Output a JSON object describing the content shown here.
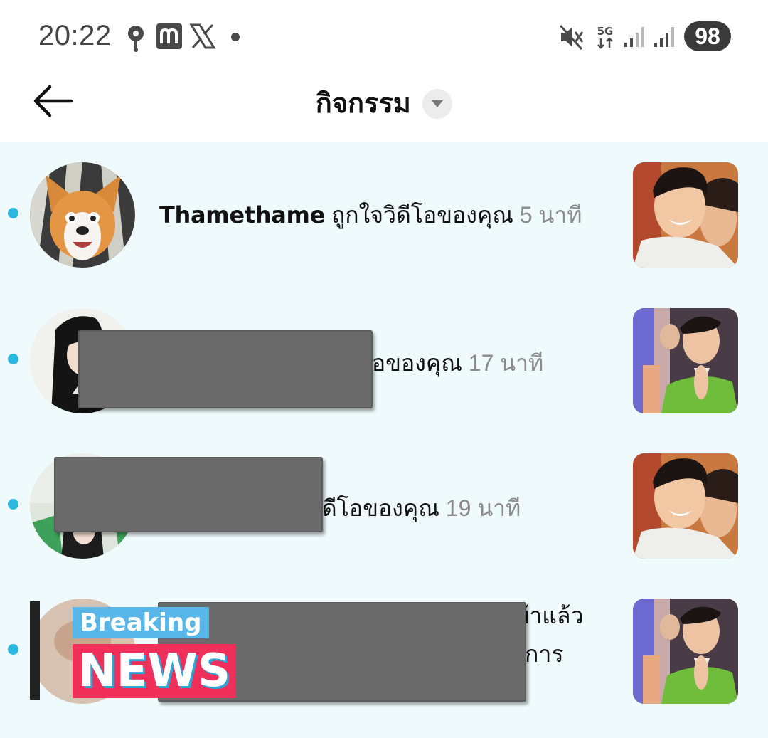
{
  "status_bar": {
    "time": "20:22",
    "left_icons": [
      "location-pin-icon",
      "m-app-icon",
      "x-logo-icon",
      "notification-dot-icon"
    ],
    "right_icons": [
      "mute-icon",
      "5g-network-icon",
      "signal-bars-icon",
      "signal-bars-icon"
    ],
    "network_label": "5G",
    "battery": "98"
  },
  "header": {
    "back_icon": "arrow-left-icon",
    "title": "กิจกรรม",
    "dropdown_icon": "caret-down-icon"
  },
  "colors": {
    "list_background": "#eefafc",
    "unread_dot": "#2ab7e0",
    "time_text": "#8b8b8b",
    "redaction": "#6a6a6a"
  },
  "activities": [
    {
      "username": "Thamethame",
      "action": "ถูกใจวิดีโอของคุณ",
      "time": "5 นาที",
      "unread": true,
      "avatar_icon": "corgi-avatar",
      "thumbnail_icon": "video-thumbnail-smiling"
    },
    {
      "visible_text": "อของคุณ",
      "time": "17 นาที",
      "unread": true,
      "redacted": true,
      "avatar_icon": "dark-hair-avatar",
      "thumbnail_icon": "video-thumbnail-green-shirt"
    },
    {
      "visible_text": "ดีโอของคุณ",
      "time": "19 นาที",
      "unread": true,
      "redacted": true,
      "avatar_icon": "portrait-avatar",
      "thumbnail_icon": "video-thumbnail-smiling"
    },
    {
      "visible_line1": "บ้าแล้ว",
      "visible_line2": "การ",
      "unread": true,
      "redacted": true,
      "avatar_icon": "sticker-avatar",
      "thumbnail_icon": "video-thumbnail-green-shirt"
    }
  ],
  "sticker": {
    "line1": "Breaking",
    "line2": "NEWS"
  }
}
